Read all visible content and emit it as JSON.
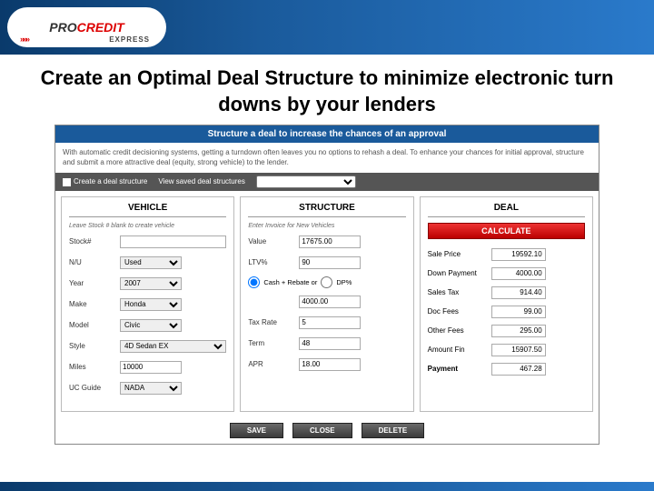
{
  "brand": {
    "part1": "PRO",
    "part2": "CREDIT",
    "tag": "EXPRESS"
  },
  "title": "Create an Optimal Deal Structure to minimize electronic turn downs by your lenders",
  "header": "Structure a deal to increase the chances of an approval",
  "intro": "With automatic credit decisioning systems, getting a turndown often leaves you no options to rehash a deal. To enhance your chances for initial approval, structure and submit a more attractive deal (equity, strong vehicle) to the lender.",
  "tabs": {
    "create": "Create a deal structure",
    "view": "View saved deal structures"
  },
  "panels": {
    "vehicle": {
      "title": "VEHICLE",
      "hint": "Leave Stock # blank to create vehicle",
      "fields": {
        "stock_label": "Stock#",
        "stock_val": "",
        "nu_label": "N/U",
        "nu_val": "Used",
        "year_label": "Year",
        "year_val": "2007",
        "make_label": "Make",
        "make_val": "Honda",
        "model_label": "Model",
        "model_val": "Civic",
        "style_label": "Style",
        "style_val": "4D Sedan EX",
        "miles_label": "Miles",
        "miles_val": "10000",
        "guide_label": "UC Guide",
        "guide_val": "NADA"
      }
    },
    "structure": {
      "title": "STRUCTURE",
      "hint": "Enter Invoice for New Vehicles",
      "fields": {
        "value_label": "Value",
        "value_val": "17675.00",
        "ltv_label": "LTV%",
        "ltv_val": "90",
        "radio_cash": "Cash + Rebate or",
        "radio_dp": "DP%",
        "cash_val": "4000.00",
        "tax_label": "Tax Rate",
        "tax_val": "5",
        "term_label": "Term",
        "term_val": "48",
        "apr_label": "APR",
        "apr_val": "18.00"
      }
    },
    "deal": {
      "title": "DEAL",
      "calc": "CALCULATE",
      "fields": {
        "sale_label": "Sale Price",
        "sale_val": "19592.10",
        "down_label": "Down Payment",
        "down_val": "4000.00",
        "tax_label": "Sales Tax",
        "tax_val": "914.40",
        "doc_label": "Doc Fees",
        "doc_val": "99.00",
        "other_label": "Other Fees",
        "other_val": "295.00",
        "amt_label": "Amount Fin",
        "amt_val": "15907.50",
        "pay_label": "Payment",
        "pay_val": "467.28"
      }
    }
  },
  "actions": {
    "save": "SAVE",
    "close": "CLOSE",
    "delete": "DELETE"
  }
}
